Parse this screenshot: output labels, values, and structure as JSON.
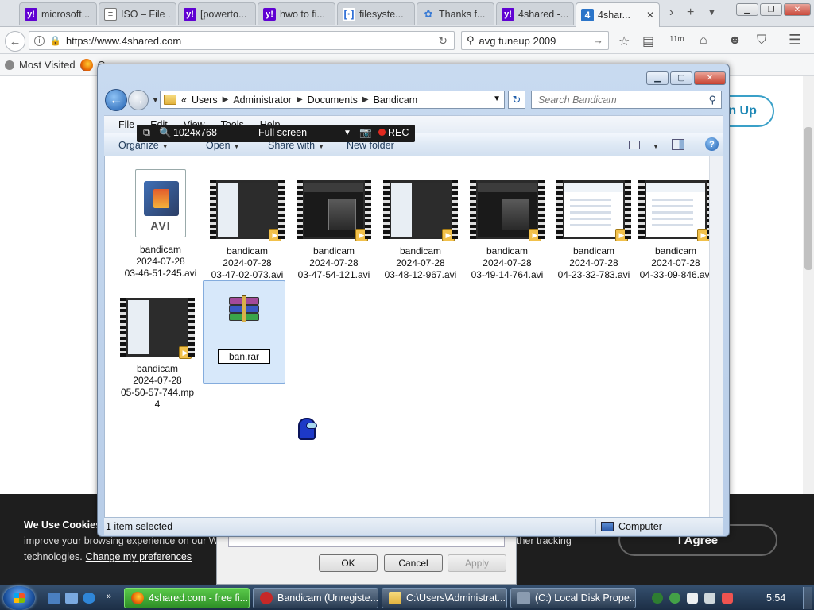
{
  "browser": {
    "tabs": [
      {
        "label": "microsoft...",
        "icon": "yahoo-icon"
      },
      {
        "label": "ISO – File ...",
        "icon": "document-icon"
      },
      {
        "label": "[powerto...",
        "icon": "yahoo-icon"
      },
      {
        "label": "hwo to fi...",
        "icon": "yahoo-icon"
      },
      {
        "label": "filesyste...",
        "icon": "brackets-icon"
      },
      {
        "label": "Thanks f...",
        "icon": "puzzle-icon"
      },
      {
        "label": "4shared -...",
        "icon": "yahoo-icon"
      },
      {
        "label": "4shar...",
        "icon": "4shared-icon",
        "active": true
      }
    ],
    "url": "https://www.4shared.com",
    "search_value": "avg tuneup 2009",
    "bookmarks": [
      {
        "label": "Most Visited"
      },
      {
        "label": "G"
      }
    ]
  },
  "site": {
    "signup_label": "ign Up",
    "cookie_title": "We Use Cookies",
    "cookie_line1": "improve your browsing experience on our We",
    "cookie_line1_right": "ther tracking",
    "cookie_line2": "technologies.",
    "cookie_link": "Change my preferences",
    "agree_label": "I Agree"
  },
  "properties_dialog": {
    "ok_label": "OK",
    "cancel_label": "Cancel",
    "apply_label": "Apply"
  },
  "explorer": {
    "breadcrumb": [
      "Users",
      "Administrator",
      "Documents",
      "Bandicam"
    ],
    "breadcrumb_prefix": "«",
    "search_placeholder": "Search Bandicam",
    "menu": [
      "File",
      "Edit",
      "View",
      "Tools",
      "Help"
    ],
    "commands": {
      "organize": "Organize",
      "open": "Open",
      "share_with": "Share with",
      "new_folder": "New folder"
    },
    "files": [
      {
        "line1": "bandicam",
        "line2": "2024-07-28",
        "line3": "03-46-51-245.avi",
        "kind": "avi"
      },
      {
        "line1": "bandicam",
        "line2": "2024-07-28",
        "line3": "03-47-02-073.avi",
        "kind": "video-mixed"
      },
      {
        "line1": "bandicam",
        "line2": "2024-07-28",
        "line3": "03-47-54-121.avi",
        "kind": "video-dark"
      },
      {
        "line1": "bandicam",
        "line2": "2024-07-28",
        "line3": "03-48-12-967.avi",
        "kind": "video-mixed"
      },
      {
        "line1": "bandicam",
        "line2": "2024-07-28",
        "line3": "03-49-14-764.avi",
        "kind": "video-dark"
      },
      {
        "line1": "bandicam",
        "line2": "2024-07-28",
        "line3": "04-23-32-783.avi",
        "kind": "video-light"
      },
      {
        "line1": "bandicam",
        "line2": "2024-07-28",
        "line3": "04-33-09-846.avi",
        "kind": "video-light"
      },
      {
        "line1": "bandicam",
        "line2": "2024-07-28",
        "line3": "05-50-57-744.mp",
        "line4": "4",
        "kind": "video-mixed"
      }
    ],
    "rename_value": "ban.rar",
    "status_left": "1 item selected",
    "status_right": "Computer"
  },
  "bandicam": {
    "resolution": "1024x768",
    "mode": "Full screen",
    "rec_label": "REC"
  },
  "taskbar": {
    "buttons": [
      {
        "label": "4shared.com - free fi...",
        "active": true
      },
      {
        "label": "Bandicam (Unregiste..."
      },
      {
        "label": "C:\\Users\\Administrat..."
      },
      {
        "label": "(C:) Local Disk Prope..."
      }
    ],
    "clock": "5:54"
  },
  "colors": {
    "accent": "#1e88b6",
    "selection": "#d7e8fa",
    "taskbar_active": "#2f8f27",
    "rec": "#e0291f"
  }
}
